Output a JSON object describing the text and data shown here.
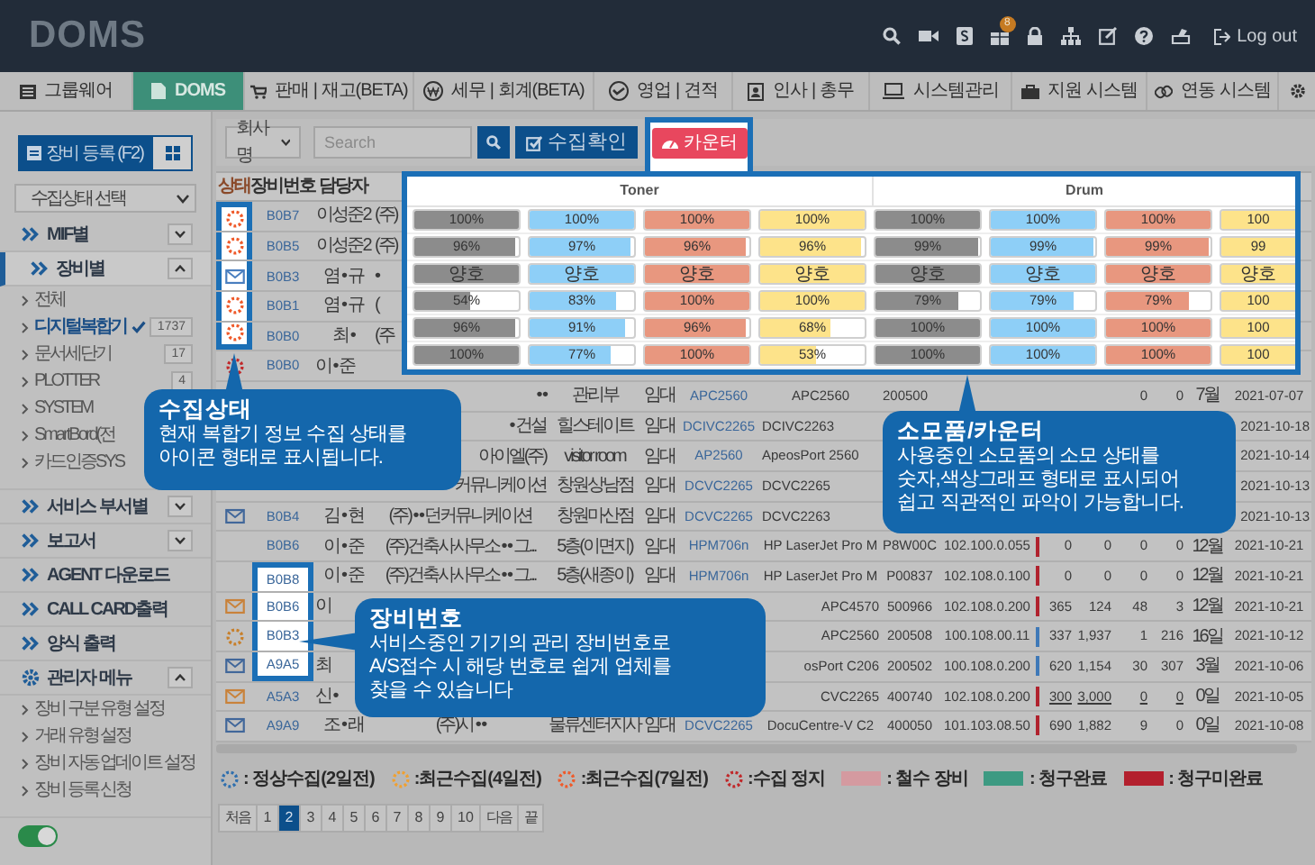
{
  "header": {
    "logo": "DOMS",
    "badge": "8",
    "logout": "Log out"
  },
  "nav": [
    {
      "label": "그룹웨어",
      "selected": false
    },
    {
      "label": "DOMS",
      "selected": true
    },
    {
      "label": "판매 | 재고(BETA)",
      "selected": false
    },
    {
      "label": "세무 | 회계(BETA)",
      "selected": false
    },
    {
      "label": "영업 | 견적",
      "selected": false
    },
    {
      "label": "인사 | 총무",
      "selected": false
    },
    {
      "label": "시스템관리",
      "selected": false
    },
    {
      "label": "지원 시스템",
      "selected": false
    },
    {
      "label": "연동 시스템",
      "selected": false
    }
  ],
  "sidebar": {
    "register_button": "장비 등록 (F2)",
    "status_select": "수집상태 선택",
    "menu": [
      {
        "kind": "group",
        "label": "MIF별",
        "expanded": false,
        "selected": false
      },
      {
        "kind": "group",
        "label": "장비별",
        "expanded": true,
        "selected": true,
        "children": [
          {
            "label": "전체",
            "selected": false
          },
          {
            "label": "디지털복합기",
            "count": "1737",
            "selected": true
          },
          {
            "label": "문서세단기",
            "count": "17",
            "selected": false
          },
          {
            "label": "PLOTTER",
            "count": "4",
            "selected": false
          },
          {
            "label": "SYSTEM",
            "selected": false
          },
          {
            "label": "SmartBord(전",
            "selected": false
          },
          {
            "label": "카드인증SYS",
            "selected": false
          }
        ]
      },
      {
        "kind": "group",
        "label": "서비스 부서별",
        "expanded": false,
        "selected": false
      },
      {
        "kind": "group",
        "label": "보고서",
        "expanded": false,
        "selected": false
      },
      {
        "kind": "link",
        "label": "AGENT 다운로드",
        "selected": false
      },
      {
        "kind": "link",
        "label": "CALL CARD출력",
        "selected": false
      },
      {
        "kind": "link",
        "label": "양식 출력",
        "selected": false
      },
      {
        "kind": "admin",
        "label": "관리자 메뉴",
        "expanded": true,
        "selected": false,
        "children": [
          {
            "label": "장비 구분 유형 설정",
            "selected": false
          },
          {
            "label": "거래 유형 설정",
            "selected": false
          },
          {
            "label": "장비 자동 업데이트 설정",
            "selected": false
          },
          {
            "label": "장비 등록 신청",
            "selected": false
          }
        ]
      }
    ],
    "toggle": {
      "on": true
    }
  },
  "toolbar": {
    "company_select": "회사명",
    "search_placeholder": "Search",
    "confirm_button": "수집확인",
    "counter_button": "카운터"
  },
  "table": {
    "status_header": "상태",
    "columns": [
      "장비번호",
      "담당자"
    ],
    "rows": [
      {
        "kind": "recent_7d",
        "status_highlighted": true,
        "number_highlighted": false,
        "cells": [
          "B0B7",
          "이성준2",
          "(주)",
          null,
          null,
          null,
          null,
          null,
          null,
          null,
          null,
          null,
          null,
          null,
          null
        ]
      },
      {
        "kind": "recent_7d",
        "status_highlighted": true,
        "number_highlighted": false,
        "cells": [
          "B0B5",
          "이성준2",
          "(주)",
          null,
          null,
          null,
          null,
          null,
          null,
          null,
          null,
          null,
          null,
          null,
          null
        ]
      },
      {
        "kind": "mail_blue",
        "status_highlighted": true,
        "number_highlighted": false,
        "cells": [
          "B0B3",
          "염 • 규",
          "•",
          null,
          null,
          null,
          null,
          null,
          null,
          null,
          null,
          null,
          null,
          null,
          null
        ]
      },
      {
        "kind": "recent_7d",
        "status_highlighted": true,
        "number_highlighted": false,
        "cells": [
          "B0B1",
          "염 • 규",
          "(",
          null,
          null,
          null,
          null,
          null,
          null,
          null,
          null,
          null,
          null,
          null,
          null
        ]
      },
      {
        "kind": "recent_7d",
        "status_highlighted": true,
        "number_highlighted": false,
        "cells": [
          "B0B0",
          "최 •",
          "(주",
          null,
          null,
          null,
          null,
          null,
          null,
          null,
          null,
          null,
          null,
          null,
          null
        ]
      },
      {
        "kind": "stopped",
        "status_highlighted": false,
        "number_highlighted": false,
        "cells": [
          "B0B0",
          "이 • 준",
          null,
          null,
          null,
          null,
          null,
          null,
          null,
          null,
          null,
          null,
          null,
          null,
          null
        ]
      },
      {
        "status_highlighted": false,
        "number_highlighted": false,
        "cells": [
          null,
          null,
          "• •",
          "관리부",
          "임대",
          "APC2560",
          "APC2560",
          "200500",
          null,
          null,
          null,
          "0",
          "0",
          "7월",
          "2021-07-07"
        ]
      },
      {
        "status_highlighted": false,
        "number_highlighted": false,
        "cells": [
          null,
          null,
          "• 건설",
          "힐스테이트",
          "임대",
          "DCIVC2265",
          "DCIVC2263",
          null,
          null,
          null,
          null,
          null,
          null,
          null,
          "2021-10-18"
        ]
      },
      {
        "status_highlighted": false,
        "number_highlighted": false,
        "cells": [
          null,
          null,
          "아이엘(주)",
          "visitor room",
          "임대",
          "AP2560",
          "ApeosPort 2560",
          null,
          null,
          null,
          null,
          null,
          null,
          null,
          "2021-10-14"
        ]
      },
      {
        "status_highlighted": false,
        "number_highlighted": false,
        "cells": [
          null,
          null,
          "커뮤니케이션",
          "창원상남점",
          "임대",
          "DCVC2265",
          "DCVC2265",
          null,
          null,
          null,
          null,
          null,
          null,
          null,
          "2021-10-13"
        ]
      },
      {
        "kind": "mail_blue",
        "status_highlighted": false,
        "number_highlighted": false,
        "cells": [
          "B0B4",
          "김 • 현",
          "(주) • • 던커뮤니케이션",
          "창원마산점",
          "임대",
          "DCVC2265",
          "DCVC2263",
          null,
          null,
          null,
          null,
          null,
          null,
          null,
          "2021-10-13"
        ]
      },
      {
        "status_highlighted": false,
        "number_highlighted": false,
        "billing_complete": false,
        "cells": [
          "B0B6",
          "이 • 준",
          "(주)건축사사무소 • • 그...",
          "5층(이면지)",
          "임대",
          "HPM706n",
          "HP LaserJet Pro M",
          "P8W00C",
          "102.100.0.055",
          "0",
          "0",
          "0",
          "0",
          "12월",
          "2021-10-21"
        ]
      },
      {
        "status_highlighted": false,
        "number_highlighted": true,
        "billing_complete": false,
        "cells": [
          "B0B8",
          "이 • 준",
          "(주)건축사사무소 • • 그...",
          "5층(새종이)",
          "임대",
          "HPM706n",
          "HP LaserJet Pro M",
          "P00837",
          "102.108.0.100",
          "0",
          "0",
          "0",
          "0",
          "12월",
          "2021-10-21"
        ]
      },
      {
        "kind": "mail_orange",
        "status_highlighted": false,
        "number_highlighted": true,
        "billing_complete": false,
        "cells": [
          "B0B6",
          "이",
          null,
          null,
          null,
          null,
          "APC4570",
          "500966",
          "102.108.0.200",
          "365",
          "124",
          "48",
          "3",
          "12월",
          "2021-10-21"
        ]
      },
      {
        "kind": "recent_4d",
        "status_highlighted": false,
        "number_highlighted": true,
        "billing_complete": true,
        "cells": [
          "B0B3",
          null,
          null,
          null,
          null,
          null,
          "APC2560",
          "200508",
          "100.108.00.11",
          "337",
          "1,937",
          "1",
          "216",
          "16일",
          "2021-10-12"
        ]
      },
      {
        "kind": "mail_blue",
        "status_highlighted": false,
        "number_highlighted": true,
        "billing_complete": true,
        "cells": [
          "A9A5",
          "최",
          null,
          null,
          null,
          null,
          "osPort C206",
          "200502",
          "100.108.0.200",
          "620",
          "1,154",
          "30",
          "307",
          "3월",
          "2021-10-06"
        ]
      },
      {
        "kind": "mail_orange",
        "status_highlighted": false,
        "number_highlighted": false,
        "billing_complete": false,
        "counts_underlined": true,
        "cells": [
          "A5A3",
          "신 •",
          null,
          null,
          null,
          null,
          "CVC2265",
          "400740",
          "102.108.0.200",
          "300",
          "3,000",
          "0",
          "0",
          "0일",
          "2021-10-05"
        ]
      },
      {
        "kind": "mail_blue",
        "status_highlighted": false,
        "number_highlighted": false,
        "billing_complete": false,
        "cells": [
          "A9A9",
          "조 • 래",
          "(주)시 • •",
          "물류센터지사",
          "임대",
          "DCVC2265",
          "DocuCentre-V C2",
          "400050",
          "101.103.08.50",
          "690",
          "1,882",
          "9",
          "0",
          "0일",
          "2021-10-08"
        ]
      }
    ]
  },
  "popup": {
    "groups": [
      "Toner",
      "Drum"
    ],
    "rows": [
      [
        {
          "text": "100%",
          "level": 1
        },
        {
          "text": "100%",
          "level": 1
        },
        {
          "text": "100%",
          "level": 1
        },
        {
          "text": "100%",
          "level": 1
        },
        {
          "text": "100%",
          "level": 1
        },
        {
          "text": "100%",
          "level": 1
        },
        {
          "text": "100%",
          "level": 1
        },
        {
          "text": "100",
          "level": 1
        }
      ],
      [
        {
          "text": "96%",
          "level": 0.96
        },
        {
          "text": "97%",
          "level": 0.97
        },
        {
          "text": "96%",
          "level": 0.96
        },
        {
          "text": "96%",
          "level": 0.96
        },
        {
          "text": "99%",
          "level": 0.99
        },
        {
          "text": "99%",
          "level": 0.99
        },
        {
          "text": "99%",
          "level": 0.99
        },
        {
          "text": "99",
          "level": 1
        }
      ],
      [
        {
          "text": "양호",
          "level": 1
        },
        {
          "text": "양호",
          "level": 1
        },
        {
          "text": "양호",
          "level": 1
        },
        {
          "text": "양호",
          "level": 1
        },
        {
          "text": "양호",
          "level": 1
        },
        {
          "text": "양호",
          "level": 1
        },
        {
          "text": "양호",
          "level": 1
        },
        {
          "text": "양호",
          "level": 1
        }
      ],
      [
        {
          "text": "54%",
          "level": 0.54
        },
        {
          "text": "83%",
          "level": 0.83
        },
        {
          "text": "100%",
          "level": 1
        },
        {
          "text": "100%",
          "level": 1
        },
        {
          "text": "79%",
          "level": 0.79
        },
        {
          "text": "79%",
          "level": 0.79
        },
        {
          "text": "79%",
          "level": 0.79
        },
        {
          "text": "100",
          "level": 1
        }
      ],
      [
        {
          "text": "96%",
          "level": 0.96
        },
        {
          "text": "91%",
          "level": 0.91
        },
        {
          "text": "96%",
          "level": 0.96
        },
        {
          "text": "68%",
          "level": 0.68
        },
        {
          "text": "100%",
          "level": 1
        },
        {
          "text": "100%",
          "level": 1
        },
        {
          "text": "100%",
          "level": 1
        },
        {
          "text": "100",
          "level": 1
        }
      ],
      [
        {
          "text": "100%",
          "level": 1
        },
        {
          "text": "77%",
          "level": 0.77
        },
        {
          "text": "100%",
          "level": 1
        },
        {
          "text": "53%",
          "level": 0.53
        },
        {
          "text": "100%",
          "level": 1
        },
        {
          "text": "100%",
          "level": 1
        },
        {
          "text": "100%",
          "level": 1
        },
        {
          "text": "100",
          "level": 1
        }
      ]
    ]
  },
  "callouts": [
    {
      "title": "수집상태",
      "lines": [
        "현재 복합기 정보 수집 상태를",
        "아이콘 형태로 표시됩니다."
      ]
    },
    {
      "title": "소모품/카운터",
      "lines": [
        "사용중인 소모품의 소모 상태를",
        "숫자,색상그래프 형태로 표시되어",
        "쉽고 직관적인 파악이 가능합니다."
      ]
    },
    {
      "title": "장비번호",
      "lines": [
        "서비스중인 기기의 관리 장비번호로",
        "A/S접수 시 해당 번호로 쉽게 업체를",
        "찾을 수 있습니다"
      ]
    }
  ],
  "legend": [
    {
      "kind": "normal",
      "label": ": 정상수집(2일전)"
    },
    {
      "kind": "recent_4d",
      "label": ":최근수집(4일전)"
    },
    {
      "kind": "recent_7d",
      "label": ":최근수집(7일전)"
    },
    {
      "kind": "stopped",
      "label": ":수집 정지"
    },
    {
      "kind": "withdrawn",
      "label": ": 철수 장비"
    },
    {
      "kind": "billed",
      "label": ": 청구완료"
    },
    {
      "kind": "unbilled",
      "label": ": 청구미완료"
    }
  ],
  "pagination": [
    {
      "label": "처음",
      "selected": false
    },
    {
      "label": "1",
      "selected": false
    },
    {
      "label": "2",
      "selected": true
    },
    {
      "label": "3",
      "selected": false
    },
    {
      "label": "4",
      "selected": false
    },
    {
      "label": "5",
      "selected": false
    },
    {
      "label": "6",
      "selected": false
    },
    {
      "label": "7",
      "selected": false
    },
    {
      "label": "8",
      "selected": false
    },
    {
      "label": "9",
      "selected": false
    },
    {
      "label": "10",
      "selected": false
    },
    {
      "label": "다음",
      "selected": false
    },
    {
      "label": "끝",
      "selected": false
    }
  ]
}
